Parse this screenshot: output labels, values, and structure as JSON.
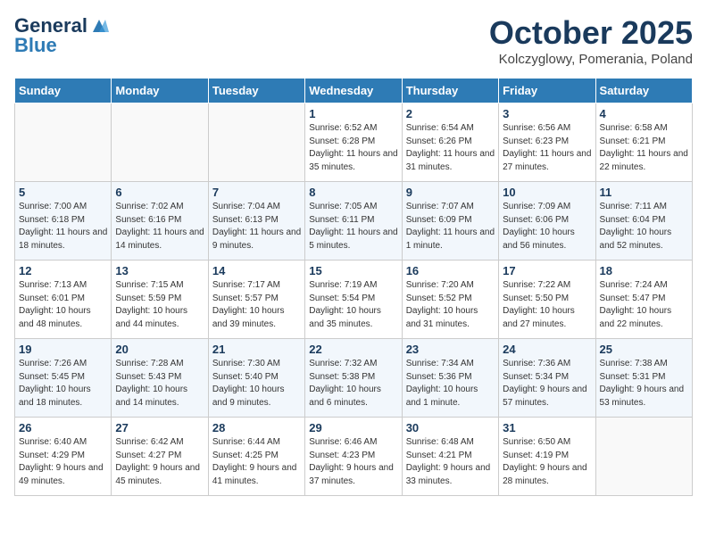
{
  "header": {
    "logo_general": "General",
    "logo_blue": "Blue",
    "month_title": "October 2025",
    "subtitle": "Kolczyglowy, Pomerania, Poland"
  },
  "weekdays": [
    "Sunday",
    "Monday",
    "Tuesday",
    "Wednesday",
    "Thursday",
    "Friday",
    "Saturday"
  ],
  "weeks": [
    [
      {
        "day": "",
        "sunrise": "",
        "sunset": "",
        "daylight": ""
      },
      {
        "day": "",
        "sunrise": "",
        "sunset": "",
        "daylight": ""
      },
      {
        "day": "",
        "sunrise": "",
        "sunset": "",
        "daylight": ""
      },
      {
        "day": "1",
        "sunrise": "Sunrise: 6:52 AM",
        "sunset": "Sunset: 6:28 PM",
        "daylight": "Daylight: 11 hours and 35 minutes."
      },
      {
        "day": "2",
        "sunrise": "Sunrise: 6:54 AM",
        "sunset": "Sunset: 6:26 PM",
        "daylight": "Daylight: 11 hours and 31 minutes."
      },
      {
        "day": "3",
        "sunrise": "Sunrise: 6:56 AM",
        "sunset": "Sunset: 6:23 PM",
        "daylight": "Daylight: 11 hours and 27 minutes."
      },
      {
        "day": "4",
        "sunrise": "Sunrise: 6:58 AM",
        "sunset": "Sunset: 6:21 PM",
        "daylight": "Daylight: 11 hours and 22 minutes."
      }
    ],
    [
      {
        "day": "5",
        "sunrise": "Sunrise: 7:00 AM",
        "sunset": "Sunset: 6:18 PM",
        "daylight": "Daylight: 11 hours and 18 minutes."
      },
      {
        "day": "6",
        "sunrise": "Sunrise: 7:02 AM",
        "sunset": "Sunset: 6:16 PM",
        "daylight": "Daylight: 11 hours and 14 minutes."
      },
      {
        "day": "7",
        "sunrise": "Sunrise: 7:04 AM",
        "sunset": "Sunset: 6:13 PM",
        "daylight": "Daylight: 11 hours and 9 minutes."
      },
      {
        "day": "8",
        "sunrise": "Sunrise: 7:05 AM",
        "sunset": "Sunset: 6:11 PM",
        "daylight": "Daylight: 11 hours and 5 minutes."
      },
      {
        "day": "9",
        "sunrise": "Sunrise: 7:07 AM",
        "sunset": "Sunset: 6:09 PM",
        "daylight": "Daylight: 11 hours and 1 minute."
      },
      {
        "day": "10",
        "sunrise": "Sunrise: 7:09 AM",
        "sunset": "Sunset: 6:06 PM",
        "daylight": "Daylight: 10 hours and 56 minutes."
      },
      {
        "day": "11",
        "sunrise": "Sunrise: 7:11 AM",
        "sunset": "Sunset: 6:04 PM",
        "daylight": "Daylight: 10 hours and 52 minutes."
      }
    ],
    [
      {
        "day": "12",
        "sunrise": "Sunrise: 7:13 AM",
        "sunset": "Sunset: 6:01 PM",
        "daylight": "Daylight: 10 hours and 48 minutes."
      },
      {
        "day": "13",
        "sunrise": "Sunrise: 7:15 AM",
        "sunset": "Sunset: 5:59 PM",
        "daylight": "Daylight: 10 hours and 44 minutes."
      },
      {
        "day": "14",
        "sunrise": "Sunrise: 7:17 AM",
        "sunset": "Sunset: 5:57 PM",
        "daylight": "Daylight: 10 hours and 39 minutes."
      },
      {
        "day": "15",
        "sunrise": "Sunrise: 7:19 AM",
        "sunset": "Sunset: 5:54 PM",
        "daylight": "Daylight: 10 hours and 35 minutes."
      },
      {
        "day": "16",
        "sunrise": "Sunrise: 7:20 AM",
        "sunset": "Sunset: 5:52 PM",
        "daylight": "Daylight: 10 hours and 31 minutes."
      },
      {
        "day": "17",
        "sunrise": "Sunrise: 7:22 AM",
        "sunset": "Sunset: 5:50 PM",
        "daylight": "Daylight: 10 hours and 27 minutes."
      },
      {
        "day": "18",
        "sunrise": "Sunrise: 7:24 AM",
        "sunset": "Sunset: 5:47 PM",
        "daylight": "Daylight: 10 hours and 22 minutes."
      }
    ],
    [
      {
        "day": "19",
        "sunrise": "Sunrise: 7:26 AM",
        "sunset": "Sunset: 5:45 PM",
        "daylight": "Daylight: 10 hours and 18 minutes."
      },
      {
        "day": "20",
        "sunrise": "Sunrise: 7:28 AM",
        "sunset": "Sunset: 5:43 PM",
        "daylight": "Daylight: 10 hours and 14 minutes."
      },
      {
        "day": "21",
        "sunrise": "Sunrise: 7:30 AM",
        "sunset": "Sunset: 5:40 PM",
        "daylight": "Daylight: 10 hours and 9 minutes."
      },
      {
        "day": "22",
        "sunrise": "Sunrise: 7:32 AM",
        "sunset": "Sunset: 5:38 PM",
        "daylight": "Daylight: 10 hours and 6 minutes."
      },
      {
        "day": "23",
        "sunrise": "Sunrise: 7:34 AM",
        "sunset": "Sunset: 5:36 PM",
        "daylight": "Daylight: 10 hours and 1 minute."
      },
      {
        "day": "24",
        "sunrise": "Sunrise: 7:36 AM",
        "sunset": "Sunset: 5:34 PM",
        "daylight": "Daylight: 9 hours and 57 minutes."
      },
      {
        "day": "25",
        "sunrise": "Sunrise: 7:38 AM",
        "sunset": "Sunset: 5:31 PM",
        "daylight": "Daylight: 9 hours and 53 minutes."
      }
    ],
    [
      {
        "day": "26",
        "sunrise": "Sunrise: 6:40 AM",
        "sunset": "Sunset: 4:29 PM",
        "daylight": "Daylight: 9 hours and 49 minutes."
      },
      {
        "day": "27",
        "sunrise": "Sunrise: 6:42 AM",
        "sunset": "Sunset: 4:27 PM",
        "daylight": "Daylight: 9 hours and 45 minutes."
      },
      {
        "day": "28",
        "sunrise": "Sunrise: 6:44 AM",
        "sunset": "Sunset: 4:25 PM",
        "daylight": "Daylight: 9 hours and 41 minutes."
      },
      {
        "day": "29",
        "sunrise": "Sunrise: 6:46 AM",
        "sunset": "Sunset: 4:23 PM",
        "daylight": "Daylight: 9 hours and 37 minutes."
      },
      {
        "day": "30",
        "sunrise": "Sunrise: 6:48 AM",
        "sunset": "Sunset: 4:21 PM",
        "daylight": "Daylight: 9 hours and 33 minutes."
      },
      {
        "day": "31",
        "sunrise": "Sunrise: 6:50 AM",
        "sunset": "Sunset: 4:19 PM",
        "daylight": "Daylight: 9 hours and 28 minutes."
      },
      {
        "day": "",
        "sunrise": "",
        "sunset": "",
        "daylight": ""
      }
    ]
  ]
}
